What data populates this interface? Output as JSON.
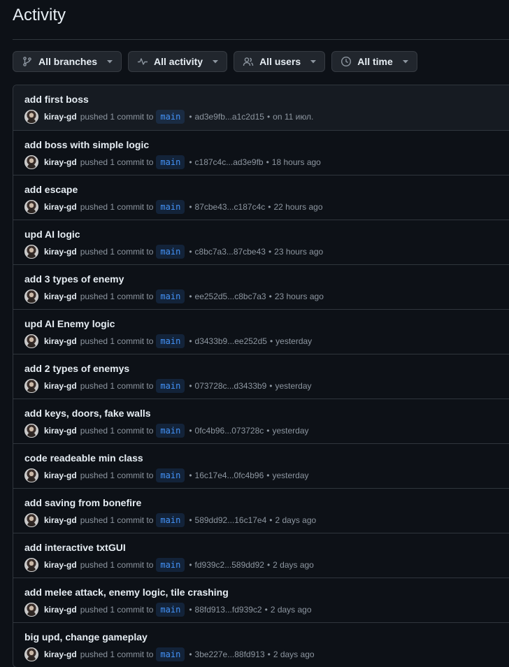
{
  "page": {
    "title": "Activity"
  },
  "filters": {
    "branches_label": "All branches",
    "activity_label": "All activity",
    "users_label": "All users",
    "time_label": "All time"
  },
  "activity": {
    "pushed_text": "pushed 1 commit to",
    "separator": "•",
    "items": [
      {
        "title": "add first boss",
        "user": "kiray-gd",
        "branch": "main",
        "range": "ad3e9fb...a1c2d15",
        "time": "on 11 июл."
      },
      {
        "title": "add boss with simple logic",
        "user": "kiray-gd",
        "branch": "main",
        "range": "c187c4c...ad3e9fb",
        "time": "18 hours ago"
      },
      {
        "title": "add escape",
        "user": "kiray-gd",
        "branch": "main",
        "range": "87cbe43...c187c4c",
        "time": "22 hours ago"
      },
      {
        "title": "upd AI logic",
        "user": "kiray-gd",
        "branch": "main",
        "range": "c8bc7a3...87cbe43",
        "time": "23 hours ago"
      },
      {
        "title": "add 3 types of enemy",
        "user": "kiray-gd",
        "branch": "main",
        "range": "ee252d5...c8bc7a3",
        "time": "23 hours ago"
      },
      {
        "title": "upd AI Enemy logic",
        "user": "kiray-gd",
        "branch": "main",
        "range": "d3433b9...ee252d5",
        "time": "yesterday"
      },
      {
        "title": "add 2 types of enemys",
        "user": "kiray-gd",
        "branch": "main",
        "range": "073728c...d3433b9",
        "time": "yesterday"
      },
      {
        "title": "add keys, doors, fake walls",
        "user": "kiray-gd",
        "branch": "main",
        "range": "0fc4b96...073728c",
        "time": "yesterday"
      },
      {
        "title": "code readeable min class",
        "user": "kiray-gd",
        "branch": "main",
        "range": "16c17e4...0fc4b96",
        "time": "yesterday"
      },
      {
        "title": "add saving from bonefire",
        "user": "kiray-gd",
        "branch": "main",
        "range": "589dd92...16c17e4",
        "time": "2 days ago"
      },
      {
        "title": "add interactive txtGUI",
        "user": "kiray-gd",
        "branch": "main",
        "range": "fd939c2...589dd92",
        "time": "2 days ago"
      },
      {
        "title": "add melee attack, enemy logic, tile crashing",
        "user": "kiray-gd",
        "branch": "main",
        "range": "88fd913...fd939c2",
        "time": "2 days ago"
      },
      {
        "title": "big upd, change gameplay",
        "user": "kiray-gd",
        "branch": "main",
        "range": "3be227e...88fd913",
        "time": "2 days ago"
      }
    ]
  }
}
